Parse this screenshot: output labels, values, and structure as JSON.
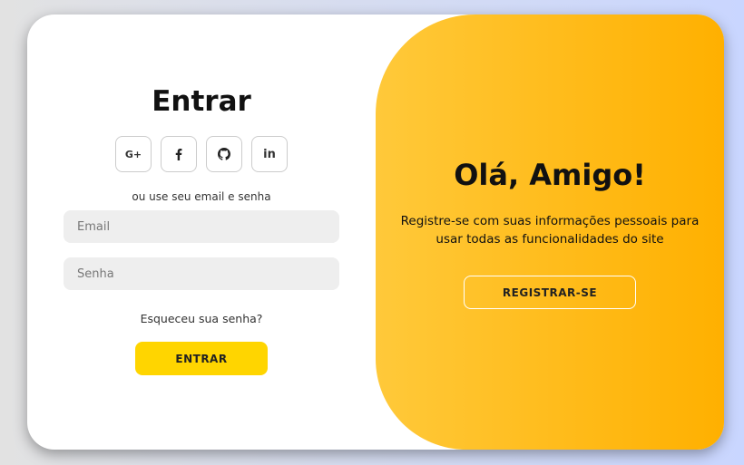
{
  "signin": {
    "title": "Entrar",
    "socials": [
      {
        "label": "G+",
        "icon": "google-plus-icon"
      },
      {
        "label": "",
        "icon": "facebook-icon"
      },
      {
        "label": "",
        "icon": "github-icon"
      },
      {
        "label": "in",
        "icon": "linkedin-icon"
      }
    ],
    "hint": "ou use seu email e senha",
    "email_placeholder": "Email",
    "password_placeholder": "Senha",
    "forgot": "Esqueceu sua senha?",
    "submit": "ENTRAR"
  },
  "panel": {
    "title": "Olá, Amigo!",
    "text": "Registre-se com suas informações pessoais para usar todas as funcionalidades do site",
    "button": "REGISTRAR-SE"
  },
  "colors": {
    "accent": "#ffd500",
    "panel_gradient_start": "#ffc93a",
    "panel_gradient_end": "#ffb000"
  }
}
